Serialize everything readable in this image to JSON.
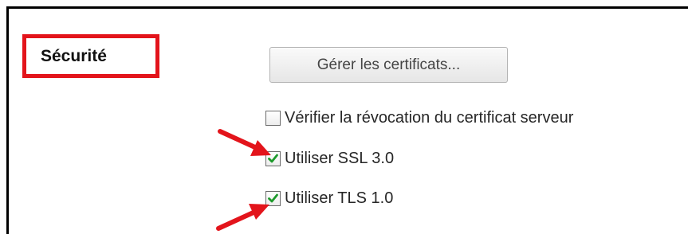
{
  "security": {
    "title": "Sécurité",
    "manage_certificates_label": "Gérer les certificats...",
    "options": [
      {
        "label": "Vérifier la révocation du certificat serveur",
        "checked": false
      },
      {
        "label": "Utiliser SSL 3.0",
        "checked": true
      },
      {
        "label": "Utiliser TLS 1.0",
        "checked": true
      }
    ]
  },
  "colors": {
    "highlight_red": "#e3141b",
    "check_green": "#1e9a2c"
  },
  "icons": [
    "checkbox-unchecked-icon",
    "checkbox-checked-icon",
    "red-arrow-icon"
  ]
}
